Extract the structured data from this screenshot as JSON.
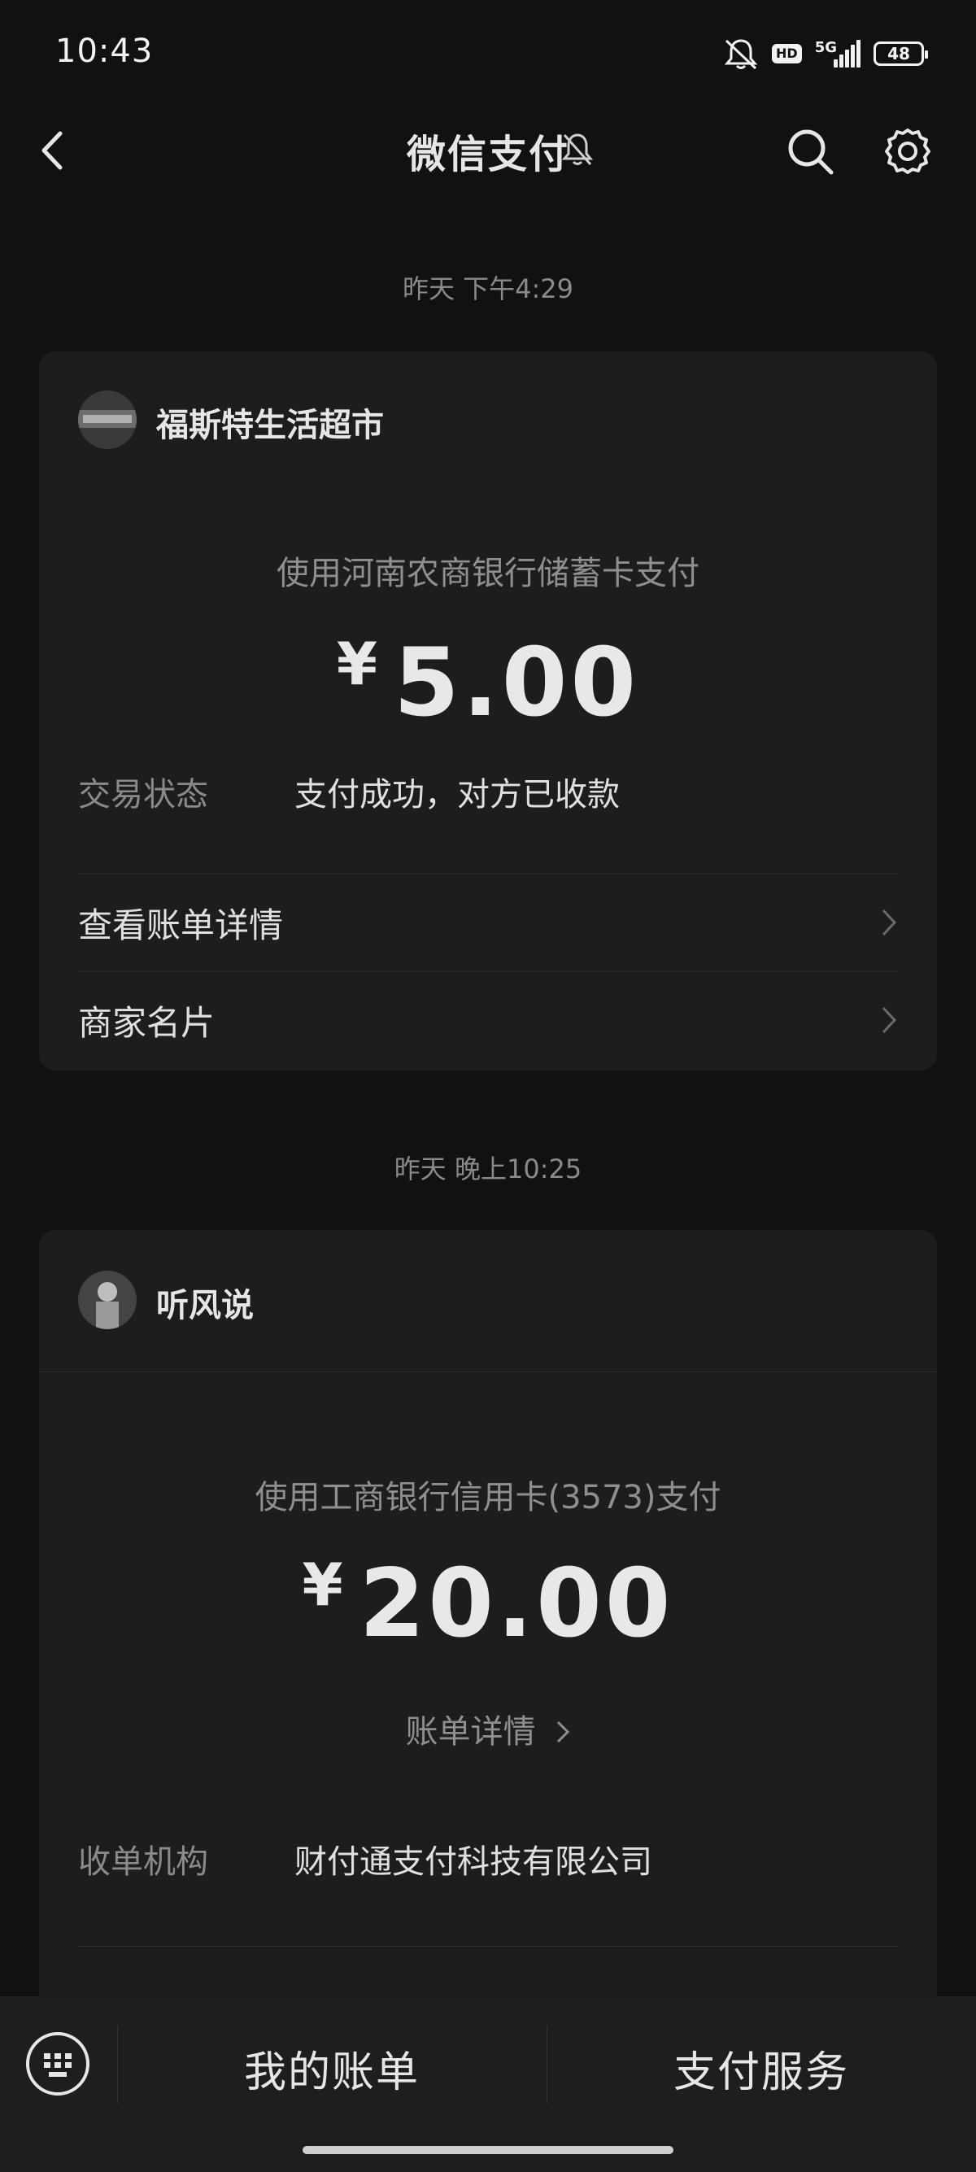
{
  "status_bar": {
    "time": "10:43",
    "hd": "HD",
    "network": "5G",
    "battery": "48"
  },
  "nav": {
    "title": "微信支付",
    "icons": [
      "back-arrow-icon",
      "mute-bell-icon",
      "search-icon",
      "gear-icon"
    ]
  },
  "messages": [
    {
      "time": "昨天 下午4:29",
      "merchant": "福斯特生活超市",
      "pay_method": "使用河南农商银行储蓄卡支付",
      "currency": "¥",
      "amount": "5.00",
      "status_label": "交易状态",
      "status_value": "支付成功，对方已收款",
      "links": [
        "查看账单详情",
        "商家名片"
      ]
    },
    {
      "time": "昨天 晚上10:25",
      "merchant": "听风说",
      "pay_method": "使用工商银行信用卡(3573)支付",
      "currency": "¥",
      "amount": "20.00",
      "bill_link": "账单详情",
      "acquirer_label": "收单机构",
      "acquirer_value": "财付通支付科技有限公司"
    }
  ],
  "bottom_bar": {
    "left": "我的账单",
    "right": "支付服务"
  },
  "colors": {
    "background": "#111111",
    "card": "#1d1d1d",
    "bottom_bar": "#1e1e1e"
  }
}
